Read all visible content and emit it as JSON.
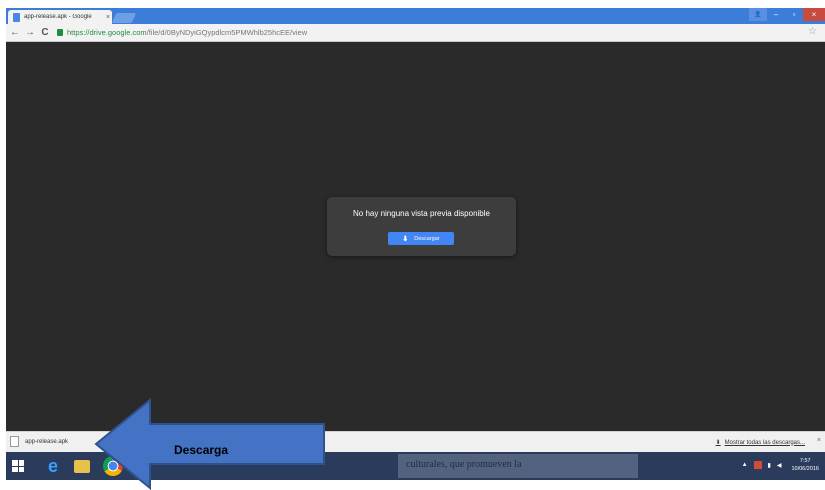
{
  "browser": {
    "tab_title": "app-release.apk - Google",
    "tab_close": "×",
    "url_scheme_host": "https://drive.google.com",
    "url_path": "/file/d/0ByNDyiGQypdlcm5PMWhlb25hcEE/view",
    "back_icon": "←",
    "forward_icon": "→",
    "reload_icon": "C",
    "star_icon": "☆",
    "win_minimize": "–",
    "win_maximize": "▫",
    "win_close": "×",
    "user_icon": "👤"
  },
  "viewer": {
    "message": "No hay ninguna vista previa disponible",
    "download_button_label": "Descargar",
    "download_icon": "⬇"
  },
  "download_shelf": {
    "file_name": "app-release.apk",
    "show_all_label": "Mostrar todas las descargas...",
    "show_all_icon": "⬇",
    "close_icon": "×"
  },
  "taskbar": {
    "ie_icon": "e",
    "background_text": "culturales,  que  promueven  la",
    "time": "7:57",
    "date": "10/06/2016"
  },
  "annotation": {
    "label": "Descarga",
    "arrow_color": "#4472c4",
    "arrow_border_color": "#2f528f"
  }
}
